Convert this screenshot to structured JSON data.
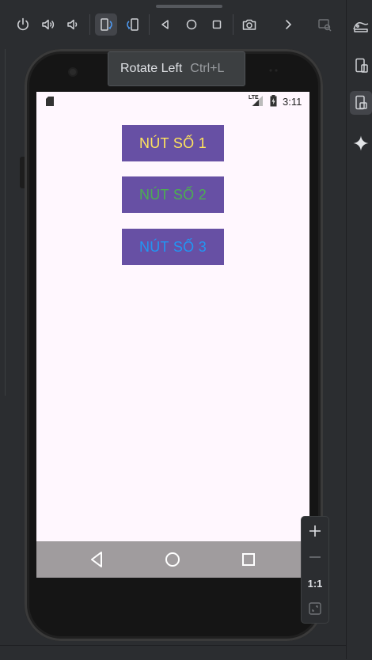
{
  "toolbar": {
    "buttons": [
      {
        "name": "power-icon"
      },
      {
        "name": "volume-up-icon"
      },
      {
        "name": "volume-down-icon"
      },
      {
        "name": "rotate-left-icon",
        "active": true
      },
      {
        "name": "rotate-right-icon"
      },
      {
        "name": "back-icon"
      },
      {
        "name": "home-icon"
      },
      {
        "name": "overview-icon"
      },
      {
        "name": "camera-icon"
      },
      {
        "name": "more-icon"
      },
      {
        "name": "screen-search-icon"
      }
    ]
  },
  "tooltip": {
    "label": "Rotate Left",
    "shortcut": "Ctrl+L"
  },
  "status_bar": {
    "network": "LTE",
    "time": "3:11"
  },
  "app": {
    "buttons": [
      {
        "label": "NÚT SỐ 1",
        "text_color": "#ffe45c"
      },
      {
        "label": "NÚT SỐ 2",
        "text_color": "#4caf50"
      },
      {
        "label": "NÚT SỐ 3",
        "text_color": "#2196f3"
      }
    ],
    "button_background": "#6750a4",
    "screen_background": "#fff7fe"
  },
  "zoom": {
    "actual_size_label": "1:1"
  },
  "right_strip": {
    "items": [
      "device-manager-icon",
      "running-devices-icon",
      "gemini-icon"
    ]
  },
  "colors": {
    "ide_background": "#2b2d30",
    "nav_bar": "#a09c9e"
  }
}
